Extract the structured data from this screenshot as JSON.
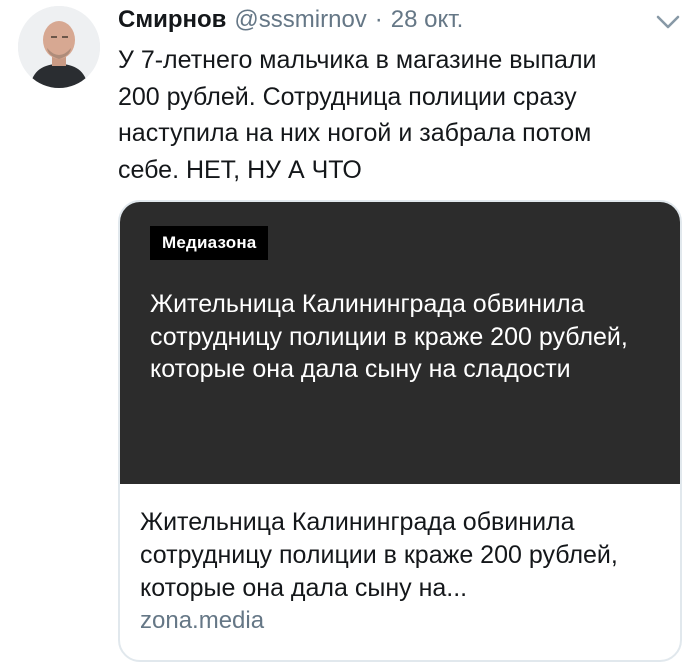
{
  "tweet": {
    "author_name": "Смирнов",
    "author_handle": "@sssmirnov",
    "separator": "·",
    "timestamp": "28 окт.",
    "text": "У 7-летнего мальчика в магазине выпали\n200 рублей. Сотрудница полиции сразу\nнаступила на них ногой и забрала потом\nсебе. НЕТ, НУ А ЧТО",
    "menu_icon": "chevron-down-icon"
  },
  "card": {
    "brand": "Медиазона",
    "image_headline": "Жительница Калининграда обвинила сотрудницу полиции в краже 200 рублей, которые она дала сыну на сладости",
    "title": "Жительница Калининграда обвинила сотрудницу полиции в краже 200 рублей, которые она дала сыну на...",
    "domain": "zona.media"
  },
  "colors": {
    "text_primary": "#14171a",
    "text_secondary": "#657786",
    "card_border": "#e1e8ed",
    "image_bg": "#2c2c2c"
  }
}
